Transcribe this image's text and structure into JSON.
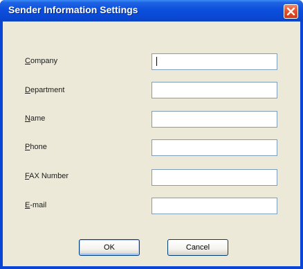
{
  "window": {
    "title": "Sender Information Settings"
  },
  "fields": [
    {
      "id": "company",
      "mnemonic": "C",
      "rest": "ompany",
      "value": ""
    },
    {
      "id": "department",
      "mnemonic": "D",
      "rest": "epartment",
      "value": ""
    },
    {
      "id": "name",
      "mnemonic": "N",
      "rest": "ame",
      "value": ""
    },
    {
      "id": "phone",
      "mnemonic": "P",
      "rest": "hone",
      "value": ""
    },
    {
      "id": "fax",
      "mnemonic": "F",
      "rest": "AX Number",
      "value": ""
    },
    {
      "id": "email",
      "mnemonic": "E",
      "rest": "-mail",
      "value": ""
    }
  ],
  "buttons": {
    "ok_label": "OK",
    "cancel_label": "Cancel"
  },
  "colors": {
    "titlebar": "#0a48d3",
    "client_background": "#ece9d8",
    "close_button": "#e5512e",
    "input_border": "#7f9db9"
  },
  "icons": {
    "close": "close-icon"
  }
}
